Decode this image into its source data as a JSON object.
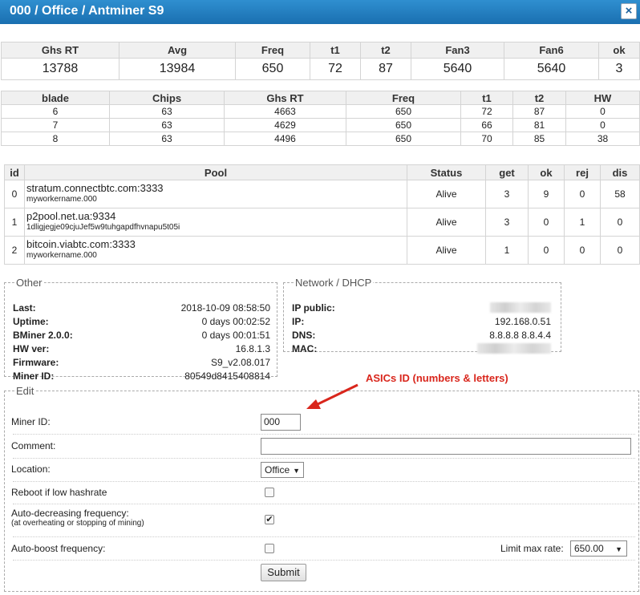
{
  "window": {
    "title": "000 / Office / Antminer S9",
    "close_label": "×"
  },
  "summary": {
    "headers": [
      "Ghs RT",
      "Avg",
      "Freq",
      "t1",
      "t2",
      "Fan3",
      "Fan6",
      "ok"
    ],
    "values": [
      "13788",
      "13984",
      "650",
      "72",
      "87",
      "5640",
      "5640",
      "3"
    ]
  },
  "blades": {
    "headers": [
      "blade",
      "Chips",
      "Ghs RT",
      "Freq",
      "t1",
      "t2",
      "HW"
    ],
    "rows": [
      [
        "6",
        "63",
        "4663",
        "650",
        "72",
        "87",
        "0"
      ],
      [
        "7",
        "63",
        "4629",
        "650",
        "66",
        "81",
        "0"
      ],
      [
        "8",
        "63",
        "4496",
        "650",
        "70",
        "85",
        "38"
      ]
    ]
  },
  "pools": {
    "headers": [
      "id",
      "Pool",
      "Status",
      "get",
      "ok",
      "rej",
      "dis"
    ],
    "rows": [
      {
        "id": "0",
        "host": "stratum.connectbtc.com:3333",
        "worker": "myworkername.000",
        "status": "Alive",
        "get": "3",
        "ok": "9",
        "rej": "0",
        "dis": "58"
      },
      {
        "id": "1",
        "host": "p2pool.net.ua:9334",
        "worker": "1dligjegje09cjuJef5w9tuhgapdfhvnapu5t05i",
        "status": "Alive",
        "get": "3",
        "ok": "0",
        "rej": "1",
        "dis": "0"
      },
      {
        "id": "2",
        "host": "bitcoin.viabtc.com:3333",
        "worker": "myworkername.000",
        "status": "Alive",
        "get": "1",
        "ok": "0",
        "rej": "0",
        "dis": "0"
      }
    ]
  },
  "other": {
    "legend": "Other",
    "rows": [
      {
        "label": "Last:",
        "value": "2018-10-09 08:58:50"
      },
      {
        "label": "Uptime:",
        "value": "0 days 00:02:52"
      },
      {
        "label": "BMiner 2.0.0:",
        "value": "0 days 00:01:51"
      },
      {
        "label": "HW ver:",
        "value": "16.8.1.3"
      },
      {
        "label": "Firmware:",
        "value": "S9_v2.08.017"
      },
      {
        "label": "Miner ID:",
        "value": "80549d8415408814"
      }
    ]
  },
  "network": {
    "legend": "Network / DHCP",
    "rows": [
      {
        "label": "IP public:",
        "value": ""
      },
      {
        "label": "IP:",
        "value": "192.168.0.51"
      },
      {
        "label": "DNS:",
        "value": "8.8.8.8 8.8.4.4"
      },
      {
        "label": "MAC:",
        "value": ""
      }
    ]
  },
  "edit": {
    "legend": "Edit",
    "miner_id_label": "Miner ID:",
    "miner_id_value": "000",
    "comment_label": "Comment:",
    "comment_value": "",
    "location_label": "Location:",
    "location_value": "Office",
    "reboot_label": "Reboot if low hashrate",
    "reboot_checked": false,
    "autodec_label": "Auto-decreasing frequency:",
    "autodec_sub": "(at overheating or stopping of mining)",
    "autodec_checked": true,
    "autoboost_label": "Auto-boost frequency:",
    "autoboost_checked": false,
    "limit_label": "Limit max rate:",
    "limit_value": "650.00",
    "submit_label": "Submit"
  },
  "annotation": {
    "text": "ASICs ID (numbers & letters)",
    "color": "#d9261c"
  }
}
